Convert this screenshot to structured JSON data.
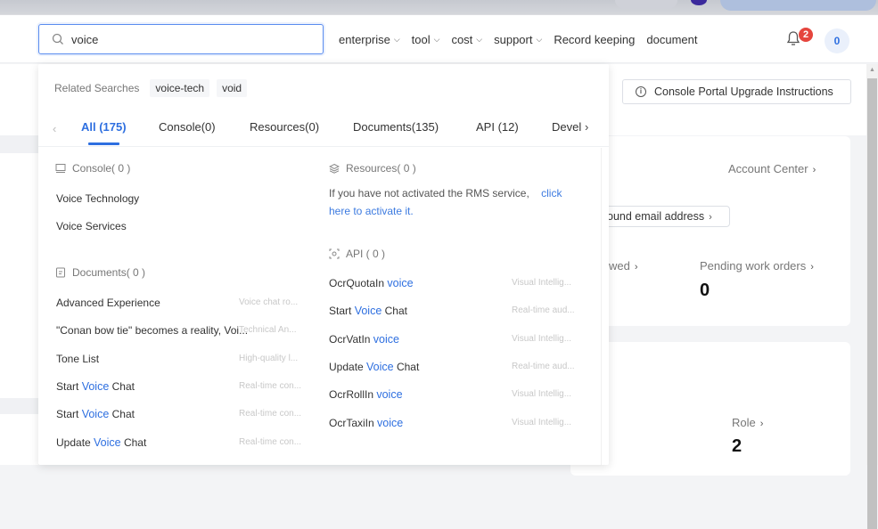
{
  "header": {
    "search_value": "voice",
    "nav": [
      {
        "label": "enterprise",
        "has_dropdown": true
      },
      {
        "label": "tool",
        "has_dropdown": true
      },
      {
        "label": "cost",
        "has_dropdown": true
      },
      {
        "label": "support",
        "has_dropdown": true
      },
      {
        "label": "Record keeping",
        "has_dropdown": false
      },
      {
        "label": "document",
        "has_dropdown": false
      }
    ],
    "notification_count": "2",
    "user_counter": "0",
    "icons": {
      "search": "search-icon",
      "bell": "bell-icon",
      "chevron": "chevron-down-icon"
    }
  },
  "page": {
    "upgrade_button": "Console Portal Upgrade Instructions",
    "account_center": "Account Center",
    "email_button": "ound email address",
    "stats": [
      {
        "label": "wed",
        "value": ""
      },
      {
        "label": "Pending work orders",
        "value": "0"
      },
      {
        "label": "Role",
        "value": "2"
      }
    ]
  },
  "dropdown": {
    "related_label": "Related Searches",
    "related_tags": [
      "voice-tech",
      "void"
    ],
    "tabs": [
      {
        "label": "All (175)",
        "active": true
      },
      {
        "label": "Console(0)",
        "active": false
      },
      {
        "label": "Resources(0)",
        "active": false
      },
      {
        "label": "Documents(135)",
        "active": false
      },
      {
        "label": "API (12)",
        "active": false
      },
      {
        "label": "Devel",
        "active": false
      }
    ],
    "console": {
      "title": "Console( 0 )",
      "items": [
        "Voice Technology",
        "Voice Services"
      ]
    },
    "documents": {
      "title": "Documents( 0 )",
      "items": [
        {
          "pre": "Advanced Experience",
          "hl": "",
          "post": "",
          "desc": "Voice chat ro..."
        },
        {
          "pre": "\"Conan bow tie\" becomes a reality, Voi...",
          "hl": "",
          "post": "",
          "desc": "Technical An..."
        },
        {
          "pre": "Tone List",
          "hl": "",
          "post": "",
          "desc": "High-quality l..."
        },
        {
          "pre": "Start ",
          "hl": "Voice",
          "post": " Chat",
          "desc": "Real-time con..."
        },
        {
          "pre": "Start ",
          "hl": "Voice",
          "post": " Chat",
          "desc": "Real-time con..."
        },
        {
          "pre": "Update ",
          "hl": "Voice",
          "post": " Chat",
          "desc": "Real-time con..."
        }
      ]
    },
    "resources": {
      "title": "Resources( 0 )",
      "note": "If you have not activated the RMS service,",
      "link": "click here to activate it."
    },
    "api": {
      "title": "API ( 0 )",
      "items": [
        {
          "pre": "OcrQuotaIn ",
          "hl": "voice",
          "post": "",
          "desc": "Visual Intellig..."
        },
        {
          "pre": "Start ",
          "hl": "Voice",
          "post": " Chat",
          "desc": "Real-time aud..."
        },
        {
          "pre": "OcrVatIn ",
          "hl": "voice",
          "post": "",
          "desc": "Visual Intellig..."
        },
        {
          "pre": "Update ",
          "hl": "Voice",
          "post": " Chat",
          "desc": "Real-time aud..."
        },
        {
          "pre": "OcrRollIn ",
          "hl": "voice",
          "post": "",
          "desc": "Visual Intellig..."
        },
        {
          "pre": "OcrTaxiIn ",
          "hl": "voice",
          "post": "",
          "desc": "Visual Intellig..."
        }
      ]
    }
  },
  "colors": {
    "accent": "#2e6fe0",
    "badge": "#e5453d"
  }
}
